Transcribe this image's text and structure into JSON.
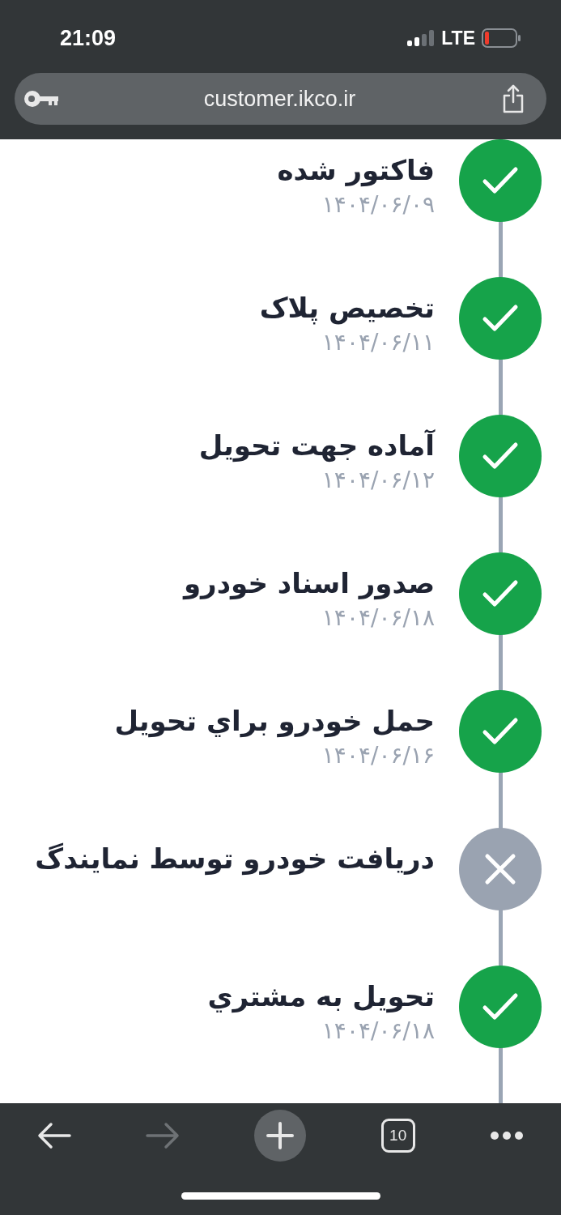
{
  "status_bar": {
    "time": "21:09",
    "network": "LTE"
  },
  "address_bar": {
    "url": "customer.ikco.ir"
  },
  "timeline": [
    {
      "title": "فاکتور شده",
      "date": "۱۴۰۴/۰۶/۰۹",
      "completed": true
    },
    {
      "title": "تخصیص پلاک",
      "date": "۱۴۰۴/۰۶/۱۱",
      "completed": true
    },
    {
      "title": "آماده جهت تحویل",
      "date": "۱۴۰۴/۰۶/۱۲",
      "completed": true
    },
    {
      "title": "صدور اسناد خودرو",
      "date": "۱۴۰۴/۰۶/۱۸",
      "completed": true
    },
    {
      "title": "حمل خودرو براي تحويل",
      "date": "۱۴۰۴/۰۶/۱۶",
      "completed": true
    },
    {
      "title": "دریافت خودرو توسط نمایندگ",
      "completed": false
    },
    {
      "title": "تحويل به مشتري",
      "date": "۱۴۰۴/۰۶/۱۸",
      "completed": true
    }
  ],
  "toolbar": {
    "forward_disabled": true,
    "tab_count": "10"
  }
}
